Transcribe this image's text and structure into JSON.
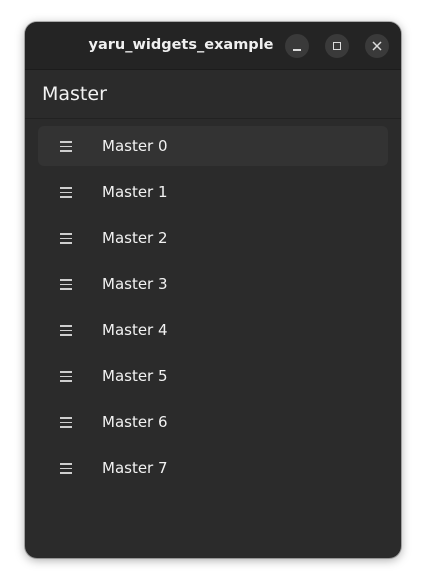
{
  "window": {
    "title": "yaru_widgets_example"
  },
  "header": {
    "title": "Master"
  },
  "list": {
    "icon": "menu-lines-icon",
    "selected_index": 0,
    "items": [
      {
        "label": "Master 0"
      },
      {
        "label": "Master 1"
      },
      {
        "label": "Master 2"
      },
      {
        "label": "Master 3"
      },
      {
        "label": "Master 4"
      },
      {
        "label": "Master 5"
      },
      {
        "label": "Master 6"
      },
      {
        "label": "Master 7"
      }
    ]
  },
  "colors": {
    "window_bg": "#2b2b2b",
    "titlebar_bg": "#242424",
    "selected_bg": "#333333",
    "text": "#f2f2f2"
  }
}
